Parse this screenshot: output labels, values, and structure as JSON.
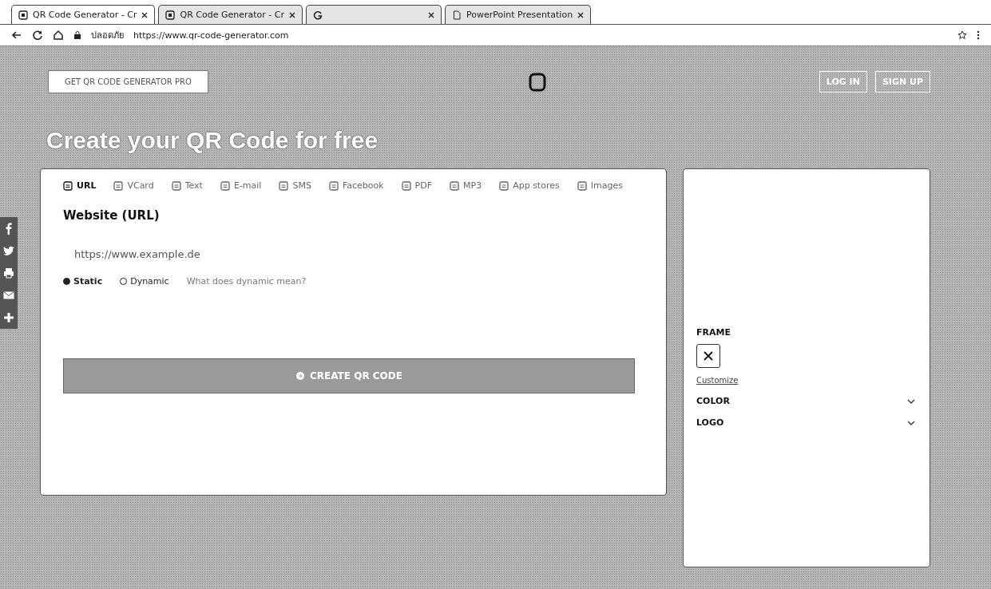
{
  "browser": {
    "tabs": [
      {
        "label": "QR Code Generator - Cr",
        "selected": true
      },
      {
        "label": "QR Code Generator - Cr",
        "selected": false
      },
      {
        "selected": false
      },
      {
        "label": "PowerPoint Presentation",
        "selected": false
      }
    ],
    "security": "ปลอดภัย",
    "url": "https://www.qr-code-generator.com"
  },
  "header": {
    "pro_button": "GET QR CODE GENERATOR PRO",
    "login": "LOG IN",
    "signup": "SIGN UP"
  },
  "title": "Create your QR Code for free",
  "types": [
    {
      "label": "URL",
      "selected": true
    },
    {
      "label": "VCard",
      "selected": false
    },
    {
      "label": "Text",
      "selected": false
    },
    {
      "label": "E-mail",
      "selected": false
    },
    {
      "label": "SMS",
      "selected": false
    },
    {
      "label": "Facebook",
      "selected": false
    },
    {
      "label": "PDF",
      "selected": false
    },
    {
      "label": "MP3",
      "selected": false
    },
    {
      "label": "App stores",
      "selected": false
    },
    {
      "label": "Images",
      "selected": false
    }
  ],
  "form": {
    "heading": "Website (URL)",
    "placeholder": "https://www.example.de",
    "modes": [
      {
        "label": "Static",
        "selected": true
      },
      {
        "label": "Dynamic",
        "selected": false
      }
    ],
    "help_link": "What does dynamic mean?",
    "submit": "CREATE QR CODE"
  },
  "side": {
    "frame_label": "FRAME",
    "customize": "Customize",
    "sections": [
      {
        "label": "COLOR",
        "expanded": false
      },
      {
        "label": "LOGO",
        "expanded": false
      }
    ]
  },
  "share": [
    {
      "kind": "facebook"
    },
    {
      "kind": "twitter"
    },
    {
      "kind": "print"
    },
    {
      "kind": "mail"
    },
    {
      "kind": "plus"
    }
  ]
}
